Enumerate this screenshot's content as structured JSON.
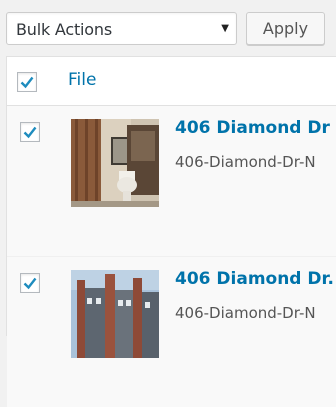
{
  "toolbar": {
    "bulk_actions_selected": "Bulk Actions",
    "apply_label": "Apply"
  },
  "table": {
    "header": {
      "select_all_checked": true,
      "file_column_label": "File"
    },
    "rows": [
      {
        "checked": true,
        "title": "406 Diamond Dr",
        "filename": "406-Diamond-Dr-N",
        "thumbnail": "bathroom-photo"
      },
      {
        "checked": true,
        "title": "406 Diamond Dr.",
        "filename": "406-Diamond-Dr-N",
        "thumbnail": "building-exterior-photo"
      }
    ]
  },
  "colors": {
    "link": "#0073aa",
    "check": "#1e8cbe"
  }
}
